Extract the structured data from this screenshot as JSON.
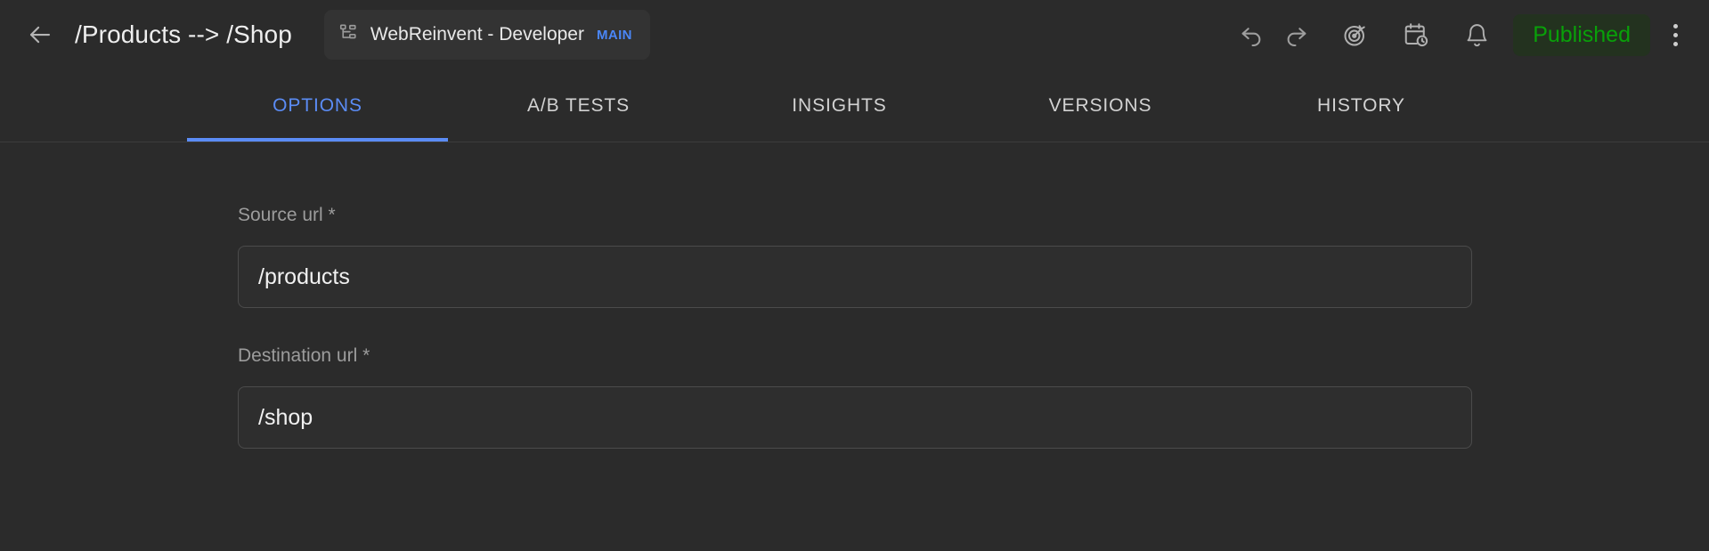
{
  "header": {
    "back_icon": "arrow-left-icon",
    "title": "/Products --> /Shop",
    "project": {
      "icon": "sitemap-icon",
      "name": "WebReinvent - Developer",
      "branch": "MAIN"
    },
    "actions": [
      {
        "name": "undo-icon",
        "label": "Undo"
      },
      {
        "name": "redo-icon",
        "label": "Redo"
      },
      {
        "name": "target-icon",
        "label": "Goals"
      },
      {
        "name": "calendar-clock-icon",
        "label": "Schedule"
      },
      {
        "name": "bell-icon",
        "label": "Notifications"
      }
    ],
    "status": {
      "label": "Published",
      "text_color": "#09a009",
      "background_color": "#23321f"
    },
    "menu_icon": "more-vertical-icon"
  },
  "tabs": [
    {
      "label": "OPTIONS",
      "active": true
    },
    {
      "label": "A/B TESTS",
      "active": false
    },
    {
      "label": "INSIGHTS",
      "active": false
    },
    {
      "label": "VERSIONS",
      "active": false
    },
    {
      "label": "HISTORY",
      "active": false
    }
  ],
  "form": {
    "source": {
      "label": "Source url *",
      "value": "/products",
      "placeholder": "Source url"
    },
    "destination": {
      "label": "Destination url *",
      "value": "/shop",
      "placeholder": "Destination url"
    }
  },
  "theme": {
    "background": "#2b2b2b",
    "accent": "#5b8cf5",
    "divider": "#3c3c3c"
  }
}
